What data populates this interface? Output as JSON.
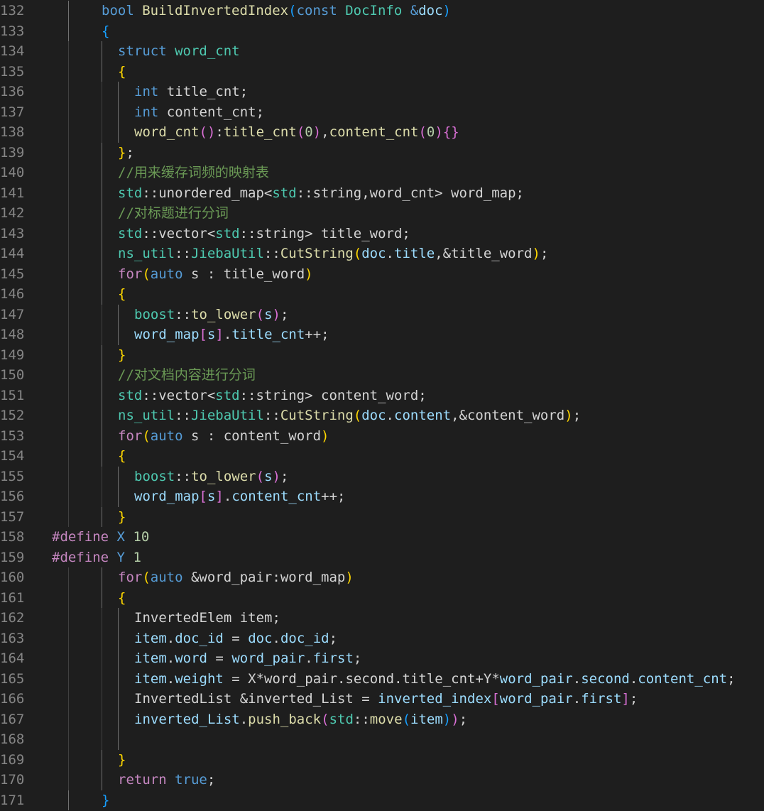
{
  "editor": {
    "language": "cpp",
    "theme_colors": {
      "background": "#1e1e1e",
      "line_number": "#858585",
      "keyword": "#569cd6",
      "control": "#c586c0",
      "type": "#4ec9b0",
      "function": "#dcdcaa",
      "variable": "#9cdcfe",
      "number": "#b5cea8",
      "comment": "#6a9955",
      "bracket_1": "#ffd700",
      "bracket_2": "#da70d6",
      "bracket_3": "#179fff"
    },
    "lines": [
      {
        "n": "132",
        "indent": 2,
        "tokens": [
          [
            "kw",
            "bool"
          ],
          [
            "txt",
            " "
          ],
          [
            "fn",
            "BuildInvertedIndex"
          ],
          [
            "b3",
            "("
          ],
          [
            "kw",
            "const"
          ],
          [
            "txt",
            " "
          ],
          [
            "ty",
            "DocInfo"
          ],
          [
            "txt",
            " "
          ],
          [
            "kw",
            "&"
          ],
          [
            "var",
            "doc"
          ],
          [
            "b3",
            ")"
          ]
        ]
      },
      {
        "n": "133",
        "indent": 2,
        "tokens": [
          [
            "b3",
            "{"
          ]
        ]
      },
      {
        "n": "134",
        "indent": 3,
        "tokens": [
          [
            "kw",
            "struct"
          ],
          [
            "txt",
            " "
          ],
          [
            "ty",
            "word_cnt"
          ]
        ]
      },
      {
        "n": "135",
        "indent": 3,
        "tokens": [
          [
            "b1",
            "{"
          ]
        ]
      },
      {
        "n": "136",
        "indent": 4,
        "tokens": [
          [
            "kw",
            "int"
          ],
          [
            "txt",
            " title_cnt;"
          ]
        ]
      },
      {
        "n": "137",
        "indent": 4,
        "tokens": [
          [
            "kw",
            "int"
          ],
          [
            "txt",
            " content_cnt;"
          ]
        ]
      },
      {
        "n": "138",
        "indent": 4,
        "tokens": [
          [
            "fn",
            "word_cnt"
          ],
          [
            "b2",
            "()"
          ],
          [
            "txt",
            ":"
          ],
          [
            "fn",
            "title_cnt"
          ],
          [
            "b2",
            "("
          ],
          [
            "num",
            "0"
          ],
          [
            "b2",
            ")"
          ],
          [
            "txt",
            ","
          ],
          [
            "fn",
            "content_cnt"
          ],
          [
            "b2",
            "("
          ],
          [
            "num",
            "0"
          ],
          [
            "b2",
            ")"
          ],
          [
            "b2",
            "{}"
          ]
        ]
      },
      {
        "n": "139",
        "indent": 3,
        "tokens": [
          [
            "b1",
            "}"
          ],
          [
            "txt",
            ";"
          ]
        ]
      },
      {
        "n": "140",
        "indent": 3,
        "tokens": [
          [
            "cmt",
            "//"
          ],
          [
            "cmtcjk",
            "用来缓存词频的映射表"
          ]
        ]
      },
      {
        "n": "141",
        "indent": 3,
        "tokens": [
          [
            "ty",
            "std"
          ],
          [
            "txt",
            "::unordered_map<"
          ],
          [
            "ty",
            "std"
          ],
          [
            "txt",
            "::string,word_cnt> word_map;"
          ]
        ]
      },
      {
        "n": "142",
        "indent": 3,
        "tokens": [
          [
            "cmt",
            "//"
          ],
          [
            "cmtcjk",
            "对标题进行分词"
          ]
        ]
      },
      {
        "n": "143",
        "indent": 3,
        "tokens": [
          [
            "ty",
            "std"
          ],
          [
            "txt",
            "::vector<"
          ],
          [
            "ty",
            "std"
          ],
          [
            "txt",
            "::string> title_word;"
          ]
        ]
      },
      {
        "n": "144",
        "indent": 3,
        "tokens": [
          [
            "ty",
            "ns_util"
          ],
          [
            "txt",
            "::"
          ],
          [
            "ty",
            "JiebaUtil"
          ],
          [
            "txt",
            "::"
          ],
          [
            "fn",
            "CutString"
          ],
          [
            "b1",
            "("
          ],
          [
            "var",
            "doc"
          ],
          [
            "txt",
            "."
          ],
          [
            "var",
            "title"
          ],
          [
            "txt",
            ",&title_word"
          ],
          [
            "b1",
            ")"
          ],
          [
            "txt",
            ";"
          ]
        ]
      },
      {
        "n": "145",
        "indent": 3,
        "tokens": [
          [
            "ctl",
            "for"
          ],
          [
            "b1",
            "("
          ],
          [
            "kw",
            "auto"
          ],
          [
            "txt",
            " s : title_word"
          ],
          [
            "b1",
            ")"
          ]
        ]
      },
      {
        "n": "146",
        "indent": 3,
        "tokens": [
          [
            "b1",
            "{"
          ]
        ]
      },
      {
        "n": "147",
        "indent": 4,
        "tokens": [
          [
            "ty",
            "boost"
          ],
          [
            "txt",
            "::"
          ],
          [
            "fn",
            "to_lower"
          ],
          [
            "b2",
            "("
          ],
          [
            "var",
            "s"
          ],
          [
            "b2",
            ")"
          ],
          [
            "txt",
            ";"
          ]
        ]
      },
      {
        "n": "148",
        "indent": 4,
        "tokens": [
          [
            "var",
            "word_map"
          ],
          [
            "b2",
            "["
          ],
          [
            "var",
            "s"
          ],
          [
            "b2",
            "]"
          ],
          [
            "txt",
            "."
          ],
          [
            "var",
            "title_cnt"
          ],
          [
            "txt",
            "++;"
          ]
        ]
      },
      {
        "n": "149",
        "indent": 3,
        "tokens": [
          [
            "b1",
            "}"
          ]
        ]
      },
      {
        "n": "150",
        "indent": 3,
        "tokens": [
          [
            "cmt",
            "//"
          ],
          [
            "cmtcjk",
            "对文档内容进行分词"
          ]
        ]
      },
      {
        "n": "151",
        "indent": 3,
        "tokens": [
          [
            "ty",
            "std"
          ],
          [
            "txt",
            "::vector<"
          ],
          [
            "ty",
            "std"
          ],
          [
            "txt",
            "::string> content_word;"
          ]
        ]
      },
      {
        "n": "152",
        "indent": 3,
        "tokens": [
          [
            "ty",
            "ns_util"
          ],
          [
            "txt",
            "::"
          ],
          [
            "ty",
            "JiebaUtil"
          ],
          [
            "txt",
            "::"
          ],
          [
            "fn",
            "CutString"
          ],
          [
            "b1",
            "("
          ],
          [
            "var",
            "doc"
          ],
          [
            "txt",
            "."
          ],
          [
            "var",
            "content"
          ],
          [
            "txt",
            ",&content_word"
          ],
          [
            "b1",
            ")"
          ],
          [
            "txt",
            ";"
          ]
        ]
      },
      {
        "n": "153",
        "indent": 3,
        "tokens": [
          [
            "ctl",
            "for"
          ],
          [
            "b1",
            "("
          ],
          [
            "kw",
            "auto"
          ],
          [
            "txt",
            " s : content_word"
          ],
          [
            "b1",
            ")"
          ]
        ]
      },
      {
        "n": "154",
        "indent": 3,
        "tokens": [
          [
            "b1",
            "{"
          ]
        ]
      },
      {
        "n": "155",
        "indent": 4,
        "tokens": [
          [
            "ty",
            "boost"
          ],
          [
            "txt",
            "::"
          ],
          [
            "fn",
            "to_lower"
          ],
          [
            "b2",
            "("
          ],
          [
            "var",
            "s"
          ],
          [
            "b2",
            ")"
          ],
          [
            "txt",
            ";"
          ]
        ]
      },
      {
        "n": "156",
        "indent": 4,
        "tokens": [
          [
            "var",
            "word_map"
          ],
          [
            "b2",
            "["
          ],
          [
            "var",
            "s"
          ],
          [
            "b2",
            "]"
          ],
          [
            "txt",
            "."
          ],
          [
            "var",
            "content_cnt"
          ],
          [
            "txt",
            "++;"
          ]
        ]
      },
      {
        "n": "157",
        "indent": 3,
        "tokens": [
          [
            "b1",
            "}"
          ]
        ]
      },
      {
        "n": "158",
        "indent": 0,
        "tokens": [
          [
            "pre",
            "#define"
          ],
          [
            "txt",
            " "
          ],
          [
            "macro",
            "X"
          ],
          [
            "txt",
            " "
          ],
          [
            "num",
            "10"
          ]
        ]
      },
      {
        "n": "159",
        "indent": 0,
        "tokens": [
          [
            "pre",
            "#define"
          ],
          [
            "txt",
            " "
          ],
          [
            "macro",
            "Y"
          ],
          [
            "txt",
            " "
          ],
          [
            "num",
            "1"
          ]
        ]
      },
      {
        "n": "160",
        "indent": 3,
        "tokens": [
          [
            "ctl",
            "for"
          ],
          [
            "b1",
            "("
          ],
          [
            "kw",
            "auto"
          ],
          [
            "txt",
            " &word_pair:word_map"
          ],
          [
            "b1",
            ")"
          ]
        ]
      },
      {
        "n": "161",
        "indent": 3,
        "tokens": [
          [
            "b1",
            "{"
          ]
        ]
      },
      {
        "n": "162",
        "indent": 4,
        "tokens": [
          [
            "txt",
            "InvertedElem item;"
          ]
        ]
      },
      {
        "n": "163",
        "indent": 4,
        "tokens": [
          [
            "var",
            "item"
          ],
          [
            "txt",
            "."
          ],
          [
            "var",
            "doc_id"
          ],
          [
            "txt",
            " = "
          ],
          [
            "var",
            "doc"
          ],
          [
            "txt",
            "."
          ],
          [
            "var",
            "doc_id"
          ],
          [
            "txt",
            ";"
          ]
        ]
      },
      {
        "n": "164",
        "indent": 4,
        "tokens": [
          [
            "var",
            "item"
          ],
          [
            "txt",
            "."
          ],
          [
            "var",
            "word"
          ],
          [
            "txt",
            " = "
          ],
          [
            "var",
            "word_pair"
          ],
          [
            "txt",
            "."
          ],
          [
            "var",
            "first"
          ],
          [
            "txt",
            ";"
          ]
        ]
      },
      {
        "n": "165",
        "indent": 4,
        "tokens": [
          [
            "var",
            "item"
          ],
          [
            "txt",
            "."
          ],
          [
            "var",
            "weight"
          ],
          [
            "txt",
            " = X*word_pair.second.title_cnt+Y*"
          ],
          [
            "var",
            "word_pair"
          ],
          [
            "txt",
            "."
          ],
          [
            "var",
            "second"
          ],
          [
            "txt",
            "."
          ],
          [
            "var",
            "content_cnt"
          ],
          [
            "txt",
            ";"
          ]
        ]
      },
      {
        "n": "166",
        "indent": 4,
        "tokens": [
          [
            "txt",
            "InvertedList &inverted_List = "
          ],
          [
            "var",
            "inverted_index"
          ],
          [
            "b2",
            "["
          ],
          [
            "var",
            "word_pair"
          ],
          [
            "txt",
            "."
          ],
          [
            "var",
            "first"
          ],
          [
            "b2",
            "]"
          ],
          [
            "txt",
            ";"
          ]
        ]
      },
      {
        "n": "167",
        "indent": 4,
        "tokens": [
          [
            "var",
            "inverted_List"
          ],
          [
            "txt",
            "."
          ],
          [
            "fn",
            "push_back"
          ],
          [
            "b2",
            "("
          ],
          [
            "ty",
            "std"
          ],
          [
            "txt",
            "::"
          ],
          [
            "fn",
            "move"
          ],
          [
            "b3",
            "("
          ],
          [
            "var",
            "item"
          ],
          [
            "b3",
            ")"
          ],
          [
            "b2",
            ")"
          ],
          [
            "txt",
            ";"
          ]
        ]
      },
      {
        "n": "168",
        "indent": 4,
        "tokens": []
      },
      {
        "n": "169",
        "indent": 3,
        "tokens": [
          [
            "b1",
            "}"
          ]
        ]
      },
      {
        "n": "170",
        "indent": 3,
        "tokens": [
          [
            "ctl",
            "return"
          ],
          [
            "txt",
            " "
          ],
          [
            "kw",
            "true"
          ],
          [
            "txt",
            ";"
          ]
        ]
      },
      {
        "n": "171",
        "indent": 2,
        "tokens": [
          [
            "b3",
            "}"
          ]
        ]
      }
    ]
  }
}
